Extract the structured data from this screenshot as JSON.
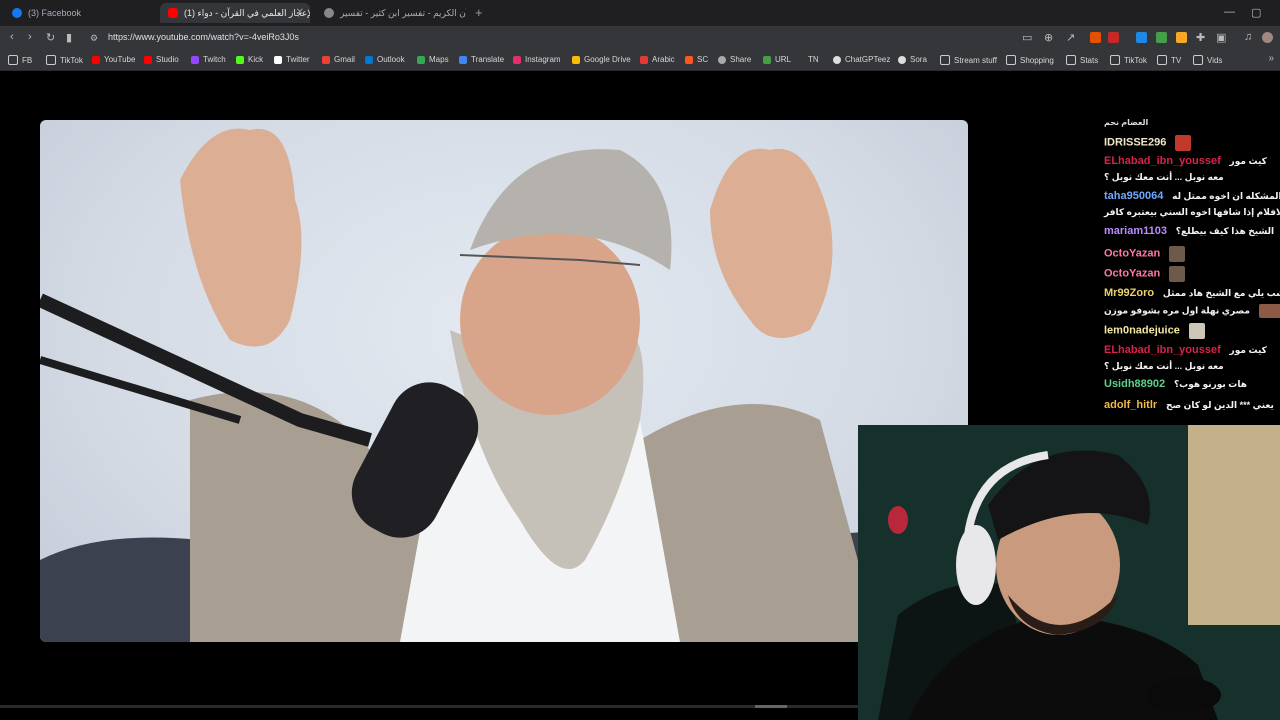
{
  "tabs": [
    {
      "title": "(3) Facebook",
      "icon": "facebook-icon",
      "color": "#1877f2"
    },
    {
      "title": "(1) الإعجاز العلمي في القرآن - دواء",
      "icon": "youtube-icon",
      "color": "#ff0000"
    },
    {
      "title": "القرآن الكريم - تفسير ابن كثير - تفسير",
      "icon": "globe-icon",
      "color": "#888888"
    }
  ],
  "address": {
    "url": "https://www.youtube.com/watch?v=-4veiRo3J0s"
  },
  "bookmarks": [
    {
      "label": "FB",
      "icon": "folder-icon",
      "color": "#cccccc"
    },
    {
      "label": "TikTok",
      "icon": "folder-icon",
      "color": "#cccccc"
    },
    {
      "label": "YouTube",
      "icon": "youtube-icon",
      "color": "#ff0000"
    },
    {
      "label": "Studio",
      "icon": "youtube-studio-icon",
      "color": "#ff0000"
    },
    {
      "label": "Twitch",
      "icon": "twitch-icon",
      "color": "#9146ff"
    },
    {
      "label": "Kick",
      "icon": "kick-icon",
      "color": "#53fc18"
    },
    {
      "label": "Twitter",
      "icon": "x-icon",
      "color": "#ffffff"
    },
    {
      "label": "Gmail",
      "icon": "gmail-icon",
      "color": "#ea4335"
    },
    {
      "label": "Outlook",
      "icon": "outlook-icon",
      "color": "#0078d4"
    },
    {
      "label": "Maps",
      "icon": "maps-icon",
      "color": "#34a853"
    },
    {
      "label": "Translate",
      "icon": "translate-icon",
      "color": "#4285f4"
    },
    {
      "label": "Instagram",
      "icon": "instagram-icon",
      "color": "#e1306c"
    },
    {
      "label": "Google Drive",
      "icon": "drive-icon",
      "color": "#fbbc04"
    },
    {
      "label": "Arabic",
      "icon": "arabic-icon",
      "color": "#e53935"
    },
    {
      "label": "SC",
      "icon": "sc-icon",
      "color": "#ff5722"
    },
    {
      "label": "Share",
      "icon": "share-icon",
      "color": "#aaaaaa"
    },
    {
      "label": "URL",
      "icon": "url-icon",
      "color": "#43a047"
    },
    {
      "label": "TN",
      "icon": "tn-icon",
      "color": "#cccccc"
    },
    {
      "label": "ChatGPTeez",
      "icon": "chatgpt-icon",
      "color": "#dddddd"
    },
    {
      "label": "Sora",
      "icon": "sora-icon",
      "color": "#dddddd"
    },
    {
      "label": "Stream stuff",
      "icon": "folder-icon",
      "color": "#cccccc"
    },
    {
      "label": "Shopping",
      "icon": "folder-icon",
      "color": "#cccccc"
    },
    {
      "label": "Stats",
      "icon": "folder-icon",
      "color": "#cccccc"
    },
    {
      "label": "TikTok",
      "icon": "folder-icon",
      "color": "#cccccc"
    },
    {
      "label": "TV",
      "icon": "folder-icon",
      "color": "#cccccc"
    },
    {
      "label": "Vids",
      "icon": "folder-icon",
      "color": "#cccccc"
    }
  ],
  "chat": {
    "header": "العضام نحم",
    "messages": [
      {
        "user": "IDRISSE296",
        "text": "",
        "color": "#f0e6c8",
        "emote": "red-emote-icon"
      },
      {
        "user": "ELhabad_ibn_youssef",
        "text": "كيث مور",
        "color": "#d8234a"
      },
      {
        "user": "",
        "text": "معه نوبل ... أنت معك نوبل ؟",
        "color": "#ffffff"
      },
      {
        "user": "taha950064",
        "text": "المشكله ان اخوه ممتل له",
        "color": "#6fa8ff"
      },
      {
        "user": "",
        "text": "الافلام إذا شافها اخوه السني بيعتبره كافر",
        "color": "#ffffff"
      },
      {
        "user": "mariam1103",
        "text": "الشيخ هذا كيف بيطلع؟",
        "color": "#b98cff"
      },
      {
        "user": "OctoYazan",
        "text": "",
        "color": "#ff7aa2",
        "emote": "face-emote-icon"
      },
      {
        "user": "OctoYazan",
        "text": "",
        "color": "#ff7aa2",
        "emote": "face-emote-icon"
      },
      {
        "user": "Mr99Zoro",
        "text": "الشب يلي مع الشيخ هاد ممثل",
        "color": "#e9d36a"
      },
      {
        "user": "",
        "text": "مصري نهلة اول مره بشوفو موزن",
        "color": "#ffffff",
        "emote": "eyes-emote-icon"
      },
      {
        "user": "lem0nadejuice",
        "text": "",
        "color": "#f3e7a0",
        "emote": "face-emote-icon"
      },
      {
        "user": "ELhabad_ibn_youssef",
        "text": "كيث مور",
        "color": "#d8234a"
      },
      {
        "user": "",
        "text": "معه نوبل ... أنت معك نوبل ؟",
        "color": "#ffffff"
      },
      {
        "user": "Usidh88902",
        "text": "هات بورنو هوب؟",
        "color": "#5fd28a"
      },
      {
        "user": "adolf_hitlr",
        "text": "يعني *** الدين لو كان صح",
        "color": "#f2b84b"
      }
    ]
  }
}
